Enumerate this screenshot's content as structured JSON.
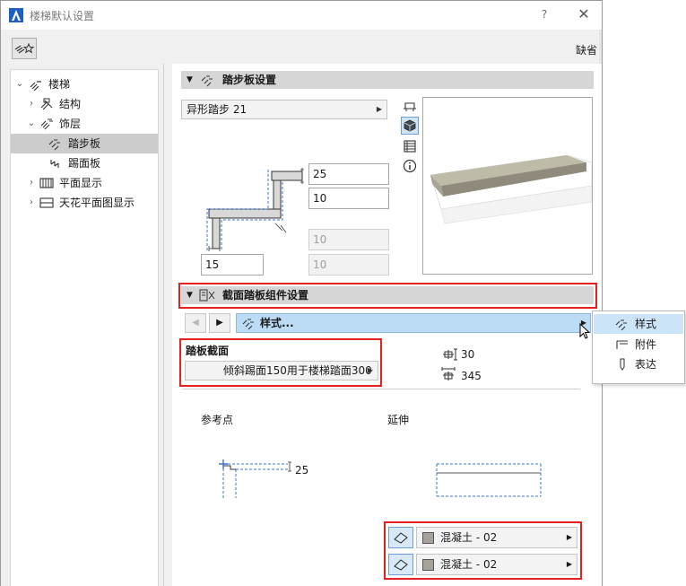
{
  "window": {
    "title": "楼梯默认设置",
    "help": "?",
    "close": "✕",
    "default_label": "缺省"
  },
  "tree": {
    "items": [
      {
        "label": "楼梯"
      },
      {
        "label": "结构"
      },
      {
        "label": "饰层"
      },
      {
        "label": "踏步板"
      },
      {
        "label": "踢面板"
      },
      {
        "label": "平面显示"
      },
      {
        "label": "天花平面图显示"
      }
    ]
  },
  "tread_section": {
    "title": "踏步板设置",
    "type_value": "异形踏步 21",
    "fields": {
      "thickness": "25",
      "nosing": "10",
      "disabled_a": "10",
      "disabled_b": "10",
      "width": "15"
    }
  },
  "profile_section": {
    "title": "截面踏板组件设置",
    "style_label": "样式...",
    "profile_label": "踏板截面",
    "profile_value": "倾斜踢面150用于楼梯踏面300",
    "dim_height": "30",
    "dim_width": "345",
    "ref_point_label": "参考点",
    "extend_label": "延伸",
    "sketch_dim": "25"
  },
  "popup_menu": {
    "items": [
      {
        "label": "样式"
      },
      {
        "label": "附件"
      },
      {
        "label": "表达"
      }
    ]
  },
  "materials": [
    {
      "label": "混凝土 - 02"
    },
    {
      "label": "混凝土 - 02"
    }
  ],
  "colors": {
    "accent_blue": "#bcdcf6",
    "highlight_red": "#e62020",
    "material_swatch": "#a7a39b"
  }
}
